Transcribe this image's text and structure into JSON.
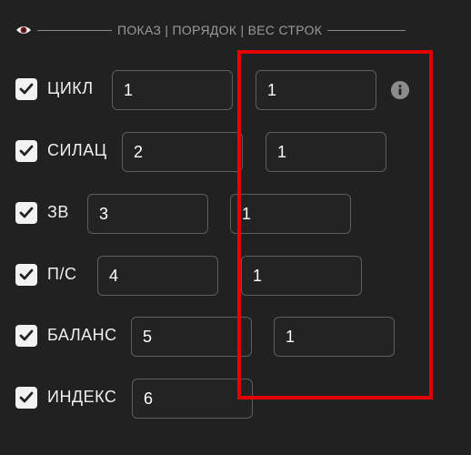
{
  "header": {
    "title": "ПОКАЗ | ПОРЯДОК | ВЕС СТРОК",
    "icon": "eye-icon"
  },
  "colors": {
    "background": "#212121",
    "highlight": "#e30000",
    "checkbox": "#f2f2f2"
  },
  "rows": [
    {
      "label": "ЦИКЛ",
      "checked": true,
      "order": "1",
      "weight": "1",
      "has_info": true
    },
    {
      "label": "СИЛАЦ",
      "checked": true,
      "order": "2",
      "weight": "1"
    },
    {
      "label": "ЗВ",
      "checked": true,
      "order": "3",
      "weight": "1"
    },
    {
      "label": "П/С",
      "checked": true,
      "order": "4",
      "weight": "1"
    },
    {
      "label": "БАЛАНС",
      "checked": true,
      "order": "5",
      "weight": "1"
    },
    {
      "label": "ИНДЕКС",
      "checked": true,
      "order": "6"
    }
  ]
}
